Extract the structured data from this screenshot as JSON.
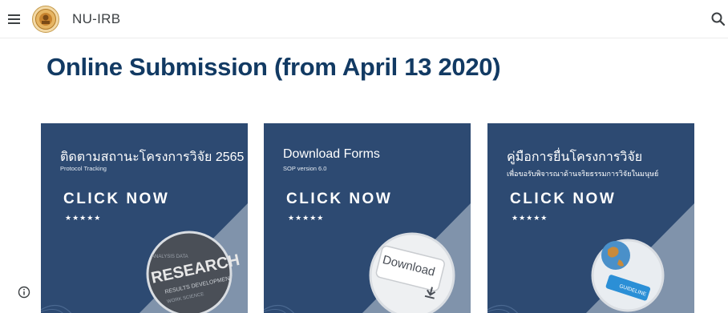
{
  "header": {
    "site_title": "NU-IRB"
  },
  "icons": {
    "menu": "hamburger-menu-icon",
    "search": "search-icon",
    "info": "info-icon",
    "logo": "university-seal-logo"
  },
  "main": {
    "title": "Online Submission (from April 13 2020)"
  },
  "cards": [
    {
      "title": "ติดตามสถานะโครงการวิจัย 2565",
      "subtitle": "Protocol Tracking",
      "cta": "CLICK NOW",
      "stars": "★★★★★",
      "image_text": "RESEARCH"
    },
    {
      "title": "Download Forms",
      "subtitle": "SOP version 6.0",
      "cta": "CLICK NOW",
      "stars": "★★★★★",
      "image_text": "Download"
    },
    {
      "title": "คู่มือการยื่นโครงการวิจัย",
      "subtitle": "เพื่อขอรับพิจารณาด้านจริยธรรมการวิจัยในมนุษย์",
      "cta": "CLICK NOW",
      "stars": "★★★★★",
      "image_text": "GUIDELINE"
    }
  ],
  "colors": {
    "title_blue": "#123a63",
    "card_bg": "#2d4a72",
    "background": "#ffffff"
  }
}
